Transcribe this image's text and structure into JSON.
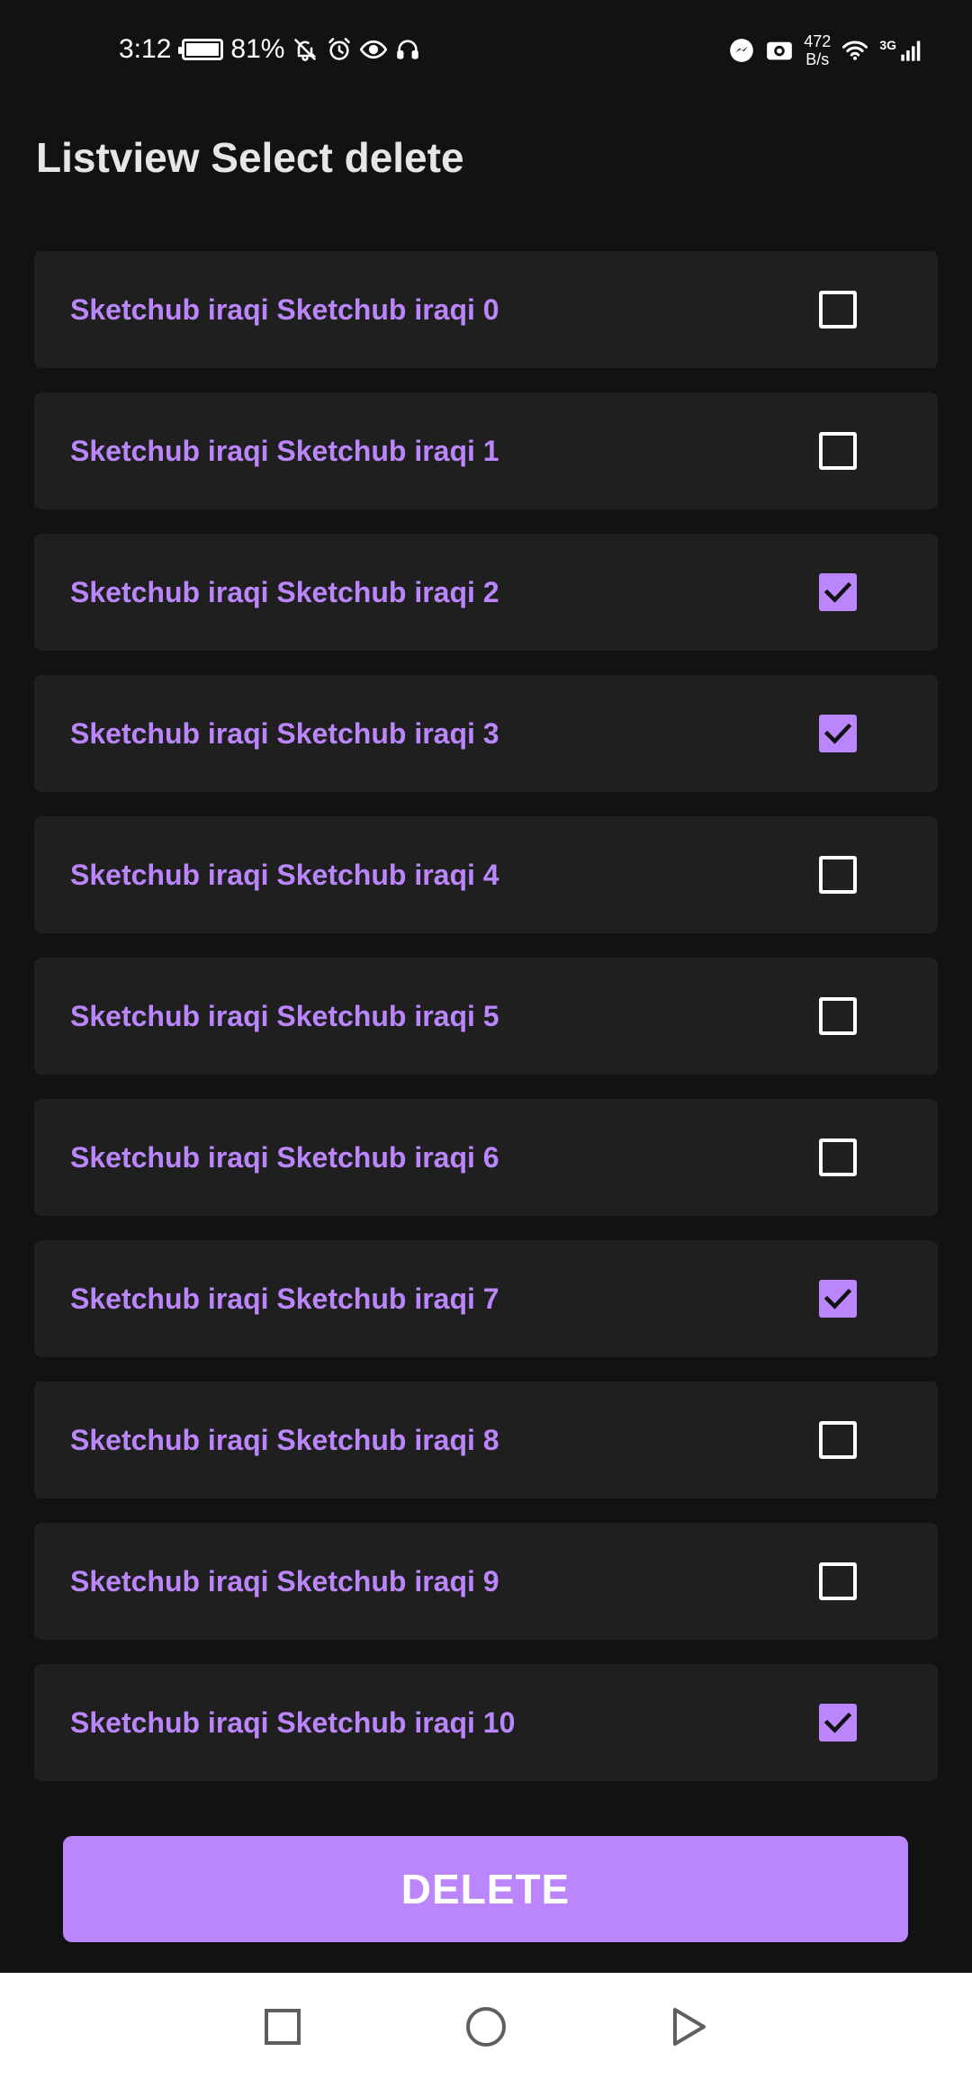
{
  "status_bar": {
    "time": "3:12",
    "battery_percent": "81%",
    "netspeed_value": "472",
    "netspeed_unit": "B/s",
    "network_type": "3G",
    "icons_left": [
      "battery-icon",
      "mute-bell-icon",
      "alarm-icon",
      "eye-icon",
      "headset-icon"
    ],
    "icons_right": [
      "messenger-icon",
      "camera-icon",
      "wifi-icon",
      "signal-icon"
    ]
  },
  "page": {
    "title": "Listview Select delete"
  },
  "list": {
    "items": [
      {
        "label": "Sketchub iraqi Sketchub iraqi 0",
        "checked": false
      },
      {
        "label": "Sketchub iraqi Sketchub iraqi 1",
        "checked": false
      },
      {
        "label": "Sketchub iraqi Sketchub iraqi 2",
        "checked": true
      },
      {
        "label": "Sketchub iraqi Sketchub iraqi 3",
        "checked": true
      },
      {
        "label": "Sketchub iraqi Sketchub iraqi 4",
        "checked": false
      },
      {
        "label": "Sketchub iraqi Sketchub iraqi 5",
        "checked": false
      },
      {
        "label": "Sketchub iraqi Sketchub iraqi 6",
        "checked": false
      },
      {
        "label": "Sketchub iraqi Sketchub iraqi 7",
        "checked": true
      },
      {
        "label": "Sketchub iraqi Sketchub iraqi 8",
        "checked": false
      },
      {
        "label": "Sketchub iraqi Sketchub iraqi 9",
        "checked": false
      },
      {
        "label": "Sketchub iraqi Sketchub iraqi 10",
        "checked": true
      }
    ]
  },
  "actions": {
    "delete_label": "DELETE"
  },
  "nav_bar": {
    "buttons": [
      "recents-icon",
      "home-icon",
      "back-icon"
    ]
  },
  "colors": {
    "background": "#121212",
    "row_background": "#1f1f1f",
    "accent": "#bb86fc",
    "text_primary": "#e6e6e6"
  }
}
